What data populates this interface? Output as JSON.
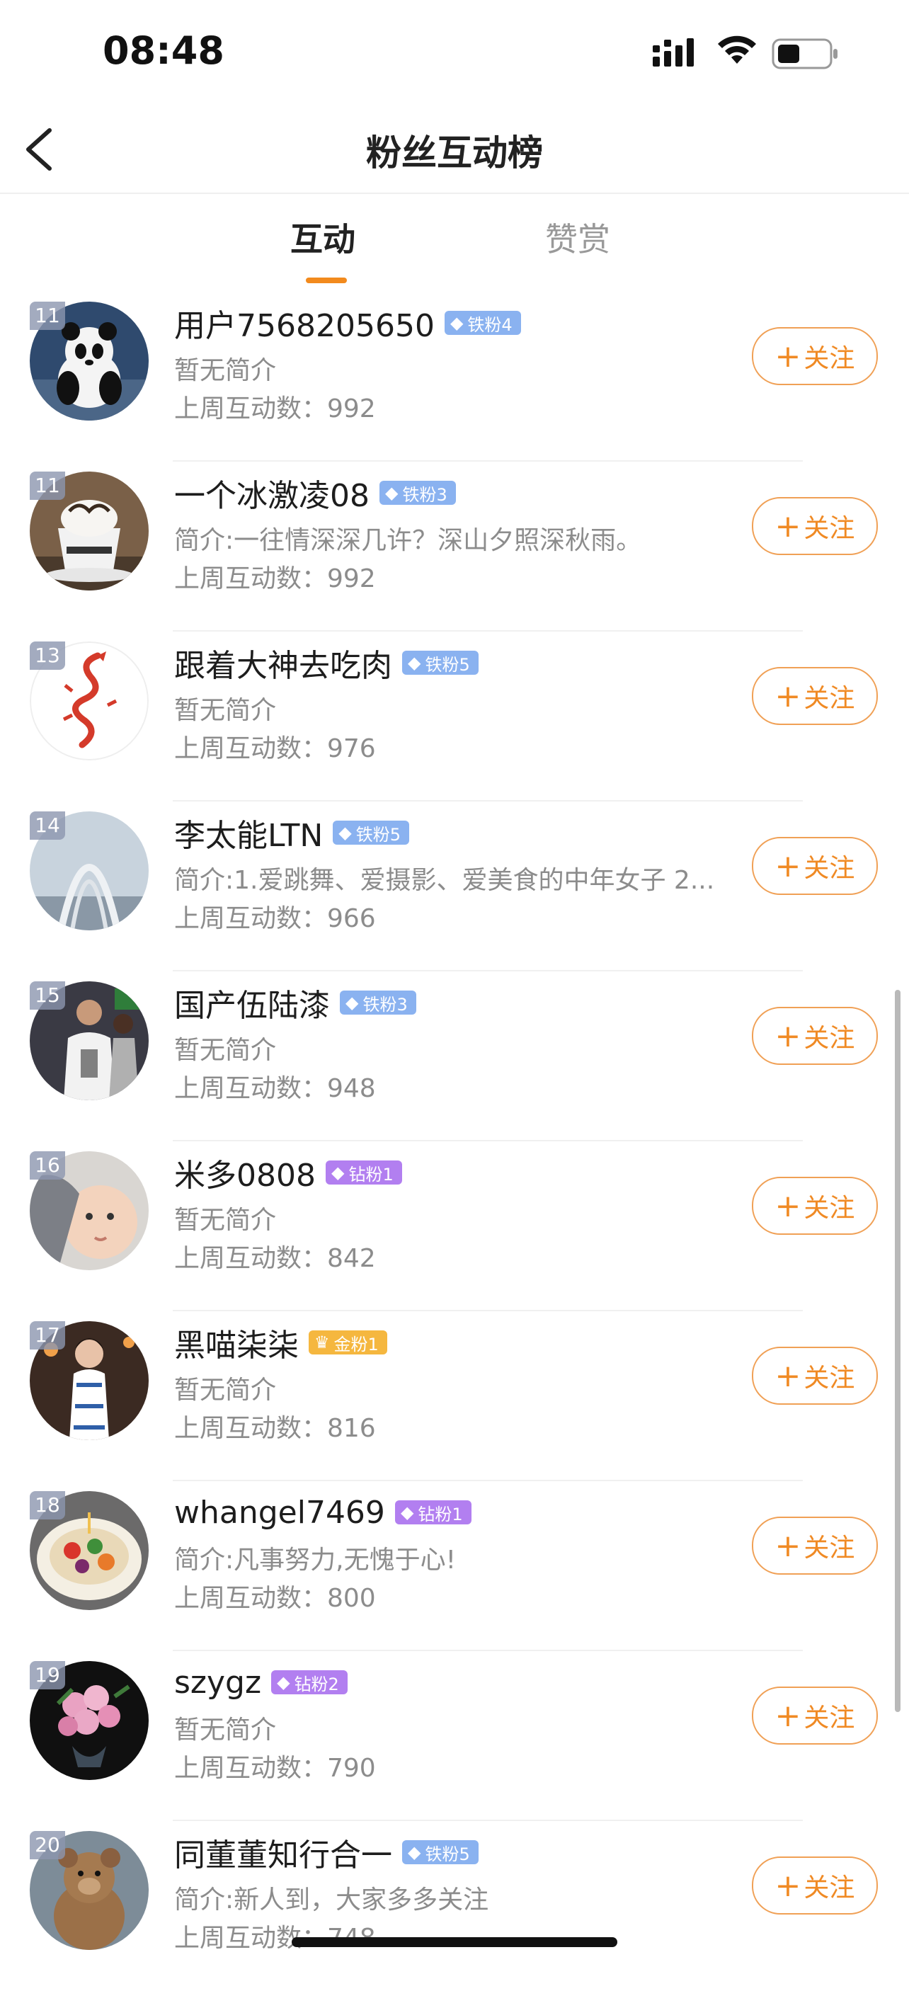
{
  "status_bar": {
    "time": "08:48"
  },
  "header": {
    "title": "粉丝互动榜"
  },
  "tabs": [
    {
      "label": "互动",
      "active": true
    },
    {
      "label": "赞赏",
      "active": false
    }
  ],
  "follow_label": "关注",
  "colors": {
    "accent": "#f08a24",
    "iron_badge": "#8ab2f0",
    "diamond_badge": "#b27ff0",
    "gold_badge": "#f5b73f"
  },
  "fans": [
    {
      "rank": "11",
      "name": "用户7568205650",
      "badge": "铁粉4",
      "badge_type": "iron",
      "bio": "暂无简介",
      "count": "上周互动数：992",
      "avatar_icon": "panda-avatar"
    },
    {
      "rank": "11",
      "name": "一个冰激凌08",
      "badge": "铁粉3",
      "badge_type": "iron",
      "bio": "简介:一往情深深几许？深山夕照深秋雨。",
      "count": "上周互动数：992",
      "avatar_icon": "coffee-avatar"
    },
    {
      "rank": "13",
      "name": "跟着大神去吃肉",
      "badge": "铁粉5",
      "badge_type": "iron",
      "bio": "暂无简介",
      "count": "上周互动数：976",
      "avatar_icon": "dragon-avatar"
    },
    {
      "rank": "14",
      "name": "李太能LTN",
      "badge": "铁粉5",
      "badge_type": "iron",
      "bio": "简介:1.爱跳舞、爱摄影、爱美食的中年女子 2....",
      "count": "上周互动数：966",
      "avatar_icon": "arch-avatar"
    },
    {
      "rank": "15",
      "name": "国产伍陆漆",
      "badge": "铁粉3",
      "badge_type": "iron",
      "bio": "暂无简介",
      "count": "上周互动数：948",
      "avatar_icon": "football-avatar"
    },
    {
      "rank": "16",
      "name": "米多0808",
      "badge": "钻粉1",
      "badge_type": "diamond",
      "bio": "暂无简介",
      "count": "上周互动数：842",
      "avatar_icon": "baby-avatar"
    },
    {
      "rank": "17",
      "name": "黑喵柒柒",
      "badge": "金粉1",
      "badge_type": "gold",
      "bio": "暂无简介",
      "count": "上周互动数：816",
      "avatar_icon": "woman-avatar"
    },
    {
      "rank": "18",
      "name": "whangel7469",
      "badge": "钻粉1",
      "badge_type": "diamond",
      "bio": "简介:凡事努力,无愧于心!",
      "count": "上周互动数：800",
      "avatar_icon": "cake-avatar"
    },
    {
      "rank": "19",
      "name": "szygz",
      "badge": "钻粉2",
      "badge_type": "diamond",
      "bio": "暂无简介",
      "count": "上周互动数：790",
      "avatar_icon": "flowers-avatar"
    },
    {
      "rank": "20",
      "name": "同董董知行合一",
      "badge": "铁粉5",
      "badge_type": "iron",
      "bio": "简介:新人到，大家多多关注",
      "count": "上周互动数：748",
      "avatar_icon": "teddy-bear-avatar"
    }
  ]
}
